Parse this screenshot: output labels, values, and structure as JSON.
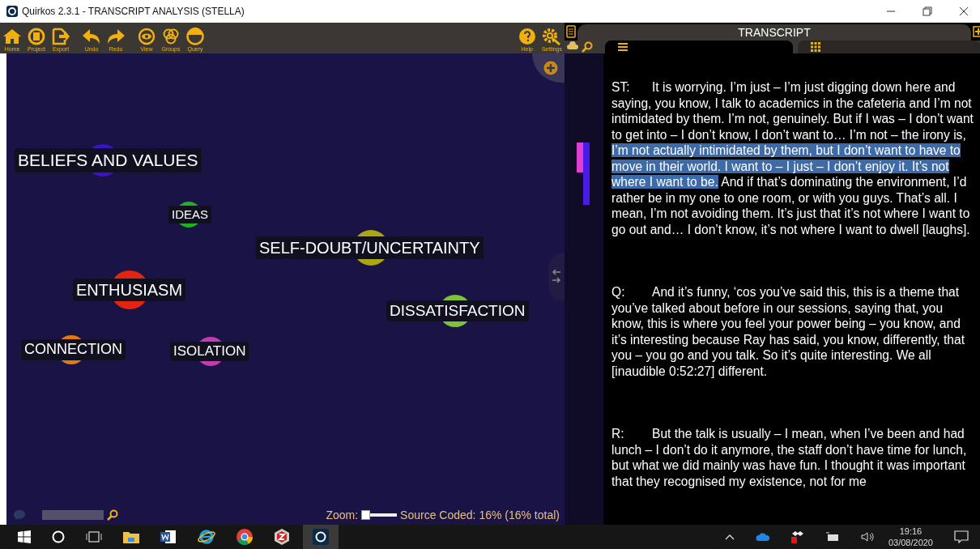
{
  "window": {
    "title": "Quirkos 2.3.1 - TRANSCRIPT ANALYSIS (STELLA)"
  },
  "toolbar": [
    {
      "label": "Home"
    },
    {
      "label": "Project"
    },
    {
      "label": "Export"
    },
    {
      "label": "Undo"
    },
    {
      "label": "Redo"
    },
    {
      "label": "View"
    },
    {
      "label": "Groups"
    },
    {
      "label": "Query"
    }
  ],
  "toolbar_right": [
    {
      "label": "Help"
    },
    {
      "label": "Settings"
    }
  ],
  "canvas": {
    "nodes": [
      {
        "label": "BELIEFS AND VALUES",
        "color": "#3c12c8"
      },
      {
        "label": "IDEAS",
        "color": "#22b022"
      },
      {
        "label": "SELF-DOUBT/UNCERTAINTY",
        "color": "#a9a812"
      },
      {
        "label": "ENTHUSIASM",
        "color": "#e32410"
      },
      {
        "label": "DISSATISFACTION",
        "color": "#7cc23a"
      },
      {
        "label": "CONNECTION",
        "color": "#e07a10"
      },
      {
        "label": "ISOLATION",
        "color": "#c23cb0"
      }
    ],
    "zoom_label": "Zoom:",
    "zoom": {
      "level": 0.0
    },
    "status": "Source Coded: 16% (16% total)"
  },
  "transcript": {
    "title": "TRANSCRIPT",
    "paragraphs": [
      {
        "speaker": "ST:",
        "segments": [
          {
            "text": "It is worrying.  I’m just – I’m just digging down here and saying, you know, I talk to academics in the cafeteria and I’m not intimidated by them.  I’m not, genuinely.  But if I was – I don’t want to get into – I don’t know, I don’t want to… I’m not – the irony is, ",
            "highlighted": false
          },
          {
            "text": "I’m not actually intimidated by them, but I don’t want to have to move in their world.  I want to – I just – I don’t enjoy it.  It’s not where I want to be.",
            "highlighted": true
          },
          {
            "text": "  And if that’s dominating the environment, I’d rather be in my one to one room, or with you guys.  That’s all.  I mean, I’m not avoiding them.  It’s just that it’s not where I want to go out and… I don’t know, it’s not where I want to dwell [laughs].",
            "highlighted": false
          }
        ]
      },
      {
        "speaker": "Q:",
        "segments": [
          {
            "text": "And it’s funny, ‘cos you’ve said this, this is a theme that you’ve talked about before in our sessions, saying that, you know, this is where you feel your power being – you know, and it’s interesting because Ray has said, you know, differently, that you – you go and you talk.  So it’s quite interesting.  We all [inaudible 0:52:27] different.",
            "highlighted": false
          }
        ]
      },
      {
        "speaker": "R:",
        "segments": [
          {
            "text": "But the talk is usually – I mean, when I’ve been and had lunch – I don’t do it anymore, the staff don’t have time for lunch, but what we did mainly was have fun.  I thought it was important that they recognised my existence, not for me",
            "highlighted": false
          }
        ]
      }
    ]
  },
  "taskbar": {
    "time": "19:16",
    "date": "03/08/2020"
  }
}
